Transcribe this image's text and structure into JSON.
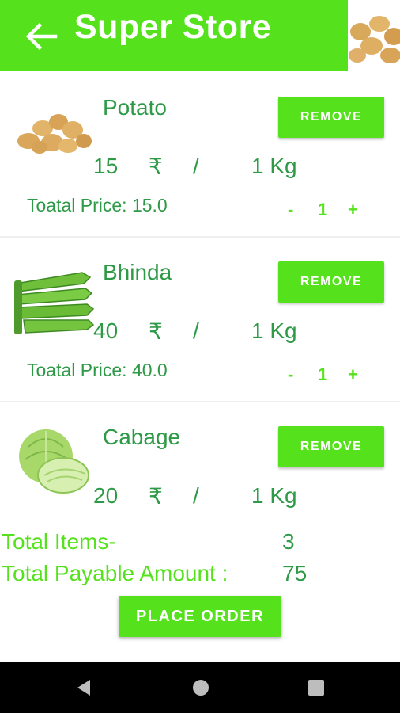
{
  "header": {
    "title": "Super Store",
    "back_icon": "arrow-left-icon"
  },
  "colors": {
    "accent": "#55e21d",
    "text_green": "#2e9a47",
    "background": "#ffffff",
    "navbar": "#000000"
  },
  "cart": [
    {
      "name": "Potato",
      "image": "potato-image",
      "remove_label": "REMOVE",
      "price": "15",
      "currency": "₹",
      "slash": "/",
      "unit": "1 Kg",
      "total_price": "Toatal Price: 15.0",
      "minus": "-",
      "qty": "1",
      "plus": "+"
    },
    {
      "name": "Bhinda",
      "image": "okra-image",
      "remove_label": "REMOVE",
      "price": "40",
      "currency": "₹",
      "slash": "/",
      "unit": "1 Kg",
      "total_price": "Toatal Price: 40.0",
      "minus": "-",
      "qty": "1",
      "plus": "+"
    },
    {
      "name": "Cabage",
      "image": "cabbage-image",
      "remove_label": "REMOVE",
      "price": "20",
      "currency": "₹",
      "slash": "/",
      "unit": "1 Kg"
    }
  ],
  "summary": {
    "items_label": "Total Items-",
    "items_value": "3",
    "amount_label": "Total Payable Amount :",
    "amount_value": "75"
  },
  "order_button": "PLACE ORDER",
  "navbar": {
    "back_icon": "triangle-back-icon",
    "home_icon": "circle-home-icon",
    "recents_icon": "square-recents-icon"
  }
}
